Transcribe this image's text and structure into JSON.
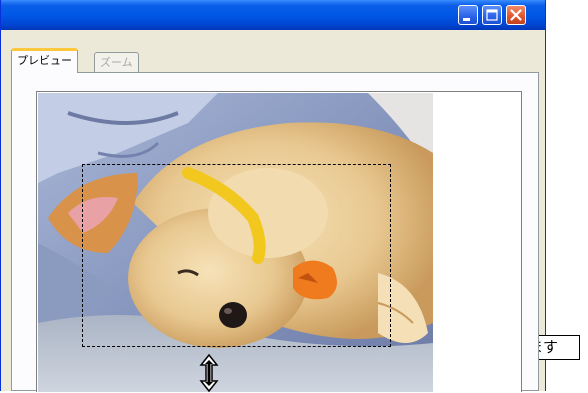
{
  "window": {
    "buttons": [
      "minimize-icon",
      "maximize-icon",
      "close-icon"
    ]
  },
  "tabs": {
    "preview_label": "プレビュー",
    "zoom_label": "ズーム"
  },
  "preview": {
    "image": "sleeping-puppy-photo"
  },
  "callout": {
    "text": "ドラッグします",
    "accent": "#ff0000"
  }
}
